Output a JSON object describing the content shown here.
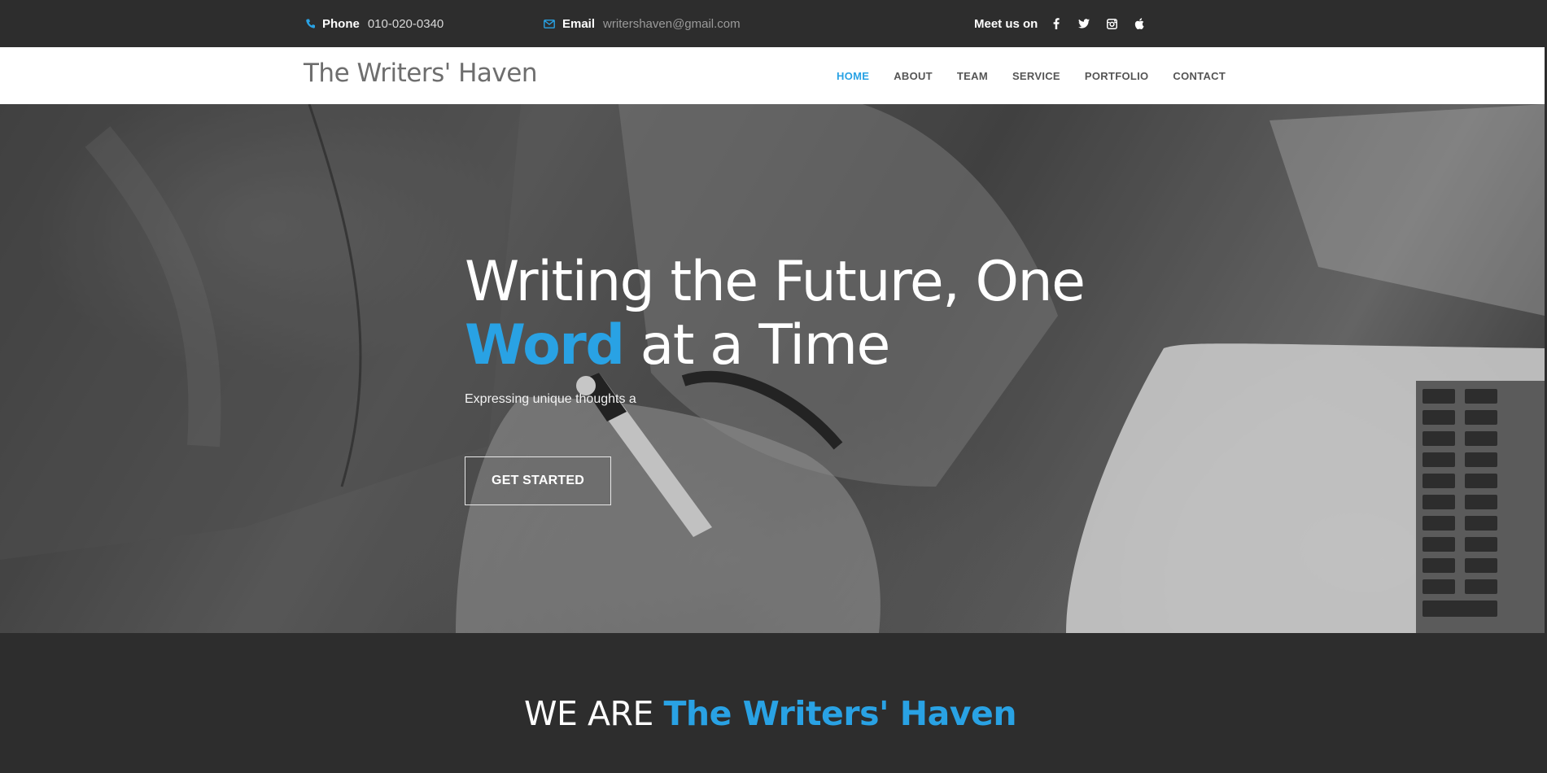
{
  "topbar": {
    "phone_label": "Phone",
    "phone_value": "010-020-0340",
    "email_label": "Email",
    "email_value": "writershaven@gmail.com",
    "social_label": "Meet us on",
    "social_icons": [
      "facebook-icon",
      "twitter-icon",
      "instagram-icon",
      "apple-icon"
    ]
  },
  "navbar": {
    "brand": "The Writers' Haven",
    "items": [
      {
        "label": "HOME",
        "active": true
      },
      {
        "label": "ABOUT",
        "active": false
      },
      {
        "label": "TEAM",
        "active": false
      },
      {
        "label": "SERVICE",
        "active": false
      },
      {
        "label": "PORTFOLIO",
        "active": false
      },
      {
        "label": "CONTACT",
        "active": false
      }
    ]
  },
  "hero": {
    "title_line1": "Writing the Future, One",
    "title_accent": "Word",
    "title_line2_rest": " at a Time",
    "subtitle": "Expressing unique thoughts a",
    "cta_label": "GET STARTED"
  },
  "about": {
    "heading_prefix": "WE ARE ",
    "heading_accent": "The Writers' Haven"
  },
  "colors": {
    "accent": "#29a2e4",
    "dark_bg": "#2d2d2d",
    "nav_bg": "#ffffff",
    "nav_text": "#555555"
  }
}
